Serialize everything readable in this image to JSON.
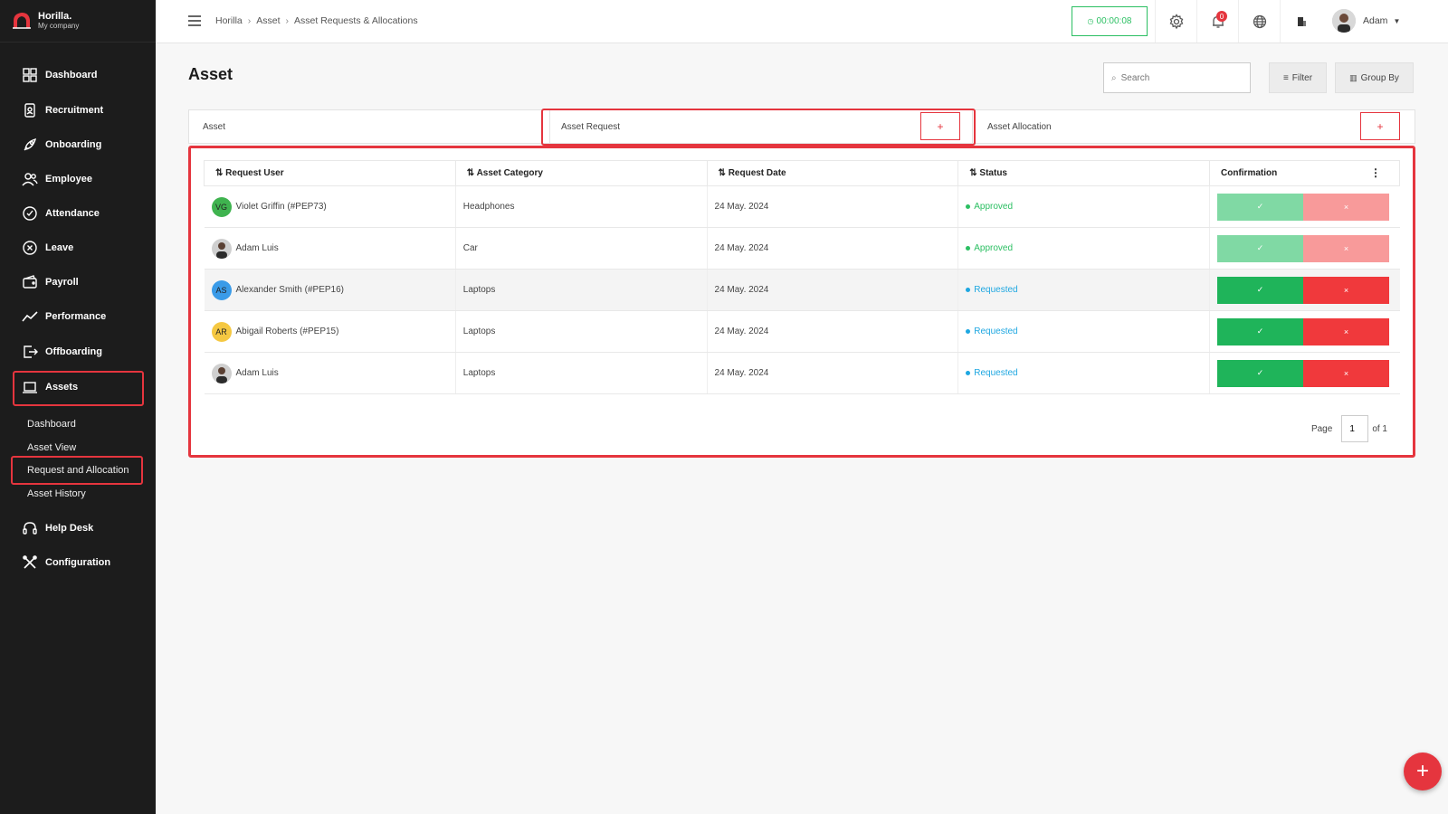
{
  "brand": {
    "name": "Horilla.",
    "company": "My company"
  },
  "sidebar": {
    "items": [
      {
        "label": "Dashboard",
        "icon": "dashboard-icon"
      },
      {
        "label": "Recruitment",
        "icon": "recruitment-icon"
      },
      {
        "label": "Onboarding",
        "icon": "rocket-icon"
      },
      {
        "label": "Employee",
        "icon": "users-icon"
      },
      {
        "label": "Attendance",
        "icon": "check-circle-icon"
      },
      {
        "label": "Leave",
        "icon": "x-circle-icon"
      },
      {
        "label": "Payroll",
        "icon": "wallet-icon"
      },
      {
        "label": "Performance",
        "icon": "trend-icon"
      },
      {
        "label": "Offboarding",
        "icon": "exit-icon"
      },
      {
        "label": "Assets",
        "icon": "laptop-icon"
      },
      {
        "label": "Help Desk",
        "icon": "headset-icon"
      },
      {
        "label": "Configuration",
        "icon": "tools-icon"
      }
    ],
    "sub_items": [
      "Dashboard",
      "Asset View",
      "Request and Allocation",
      "Asset History"
    ]
  },
  "topbar": {
    "breadcrumb": [
      "Horilla",
      "Asset",
      "Asset Requests & Allocations"
    ],
    "timer": "00:00:08",
    "notification_count": "0",
    "user_name": "Adam"
  },
  "page": {
    "title": "Asset",
    "search_placeholder": "Search",
    "filter_label": "Filter",
    "group_by_label": "Group By"
  },
  "tabs": [
    {
      "label": "Asset"
    },
    {
      "label": "Asset Request",
      "add": "+"
    },
    {
      "label": "Asset Allocation",
      "add": "+"
    }
  ],
  "table": {
    "columns": [
      "Request User",
      "Asset Category",
      "Request Date",
      "Status",
      "Confirmation"
    ],
    "rows": [
      {
        "user": "Violet Griffin (#PEP73)",
        "initials": "VG",
        "avatar_color": "#3fb34f",
        "category": "Headphones",
        "date": "24 May. 2024",
        "status": "Approved",
        "status_color": "#2bbf62"
      },
      {
        "user": "Adam Luis",
        "initials": "",
        "avatar_color": "#cfcfcf",
        "category": "Car",
        "date": "24 May. 2024",
        "status": "Approved",
        "status_color": "#2bbf62"
      },
      {
        "user": "Alexander Smith (#PEP16)",
        "initials": "AS",
        "avatar_color": "#3a9be8",
        "category": "Laptops",
        "date": "24 May. 2024",
        "status": "Requested",
        "status_color": "#1ea7e1"
      },
      {
        "user": "Abigail Roberts (#PEP15)",
        "initials": "AR",
        "avatar_color": "#f5c842",
        "category": "Laptops",
        "date": "24 May. 2024",
        "status": "Requested",
        "status_color": "#1ea7e1"
      },
      {
        "user": "Adam Luis",
        "initials": "",
        "avatar_color": "#cfcfcf",
        "category": "Laptops",
        "date": "24 May. 2024",
        "status": "Requested",
        "status_color": "#1ea7e1"
      }
    ],
    "approve_symbol": "✓",
    "reject_symbol": "×"
  },
  "pagination": {
    "page_label": "Page",
    "current": "1",
    "of_label": "of 1"
  },
  "colors": {
    "accent": "#e5353e",
    "approve": "#1fb45a",
    "reject": "#f0393c",
    "approve_faded": "#80d9a4",
    "reject_faded": "#f89a9a"
  }
}
